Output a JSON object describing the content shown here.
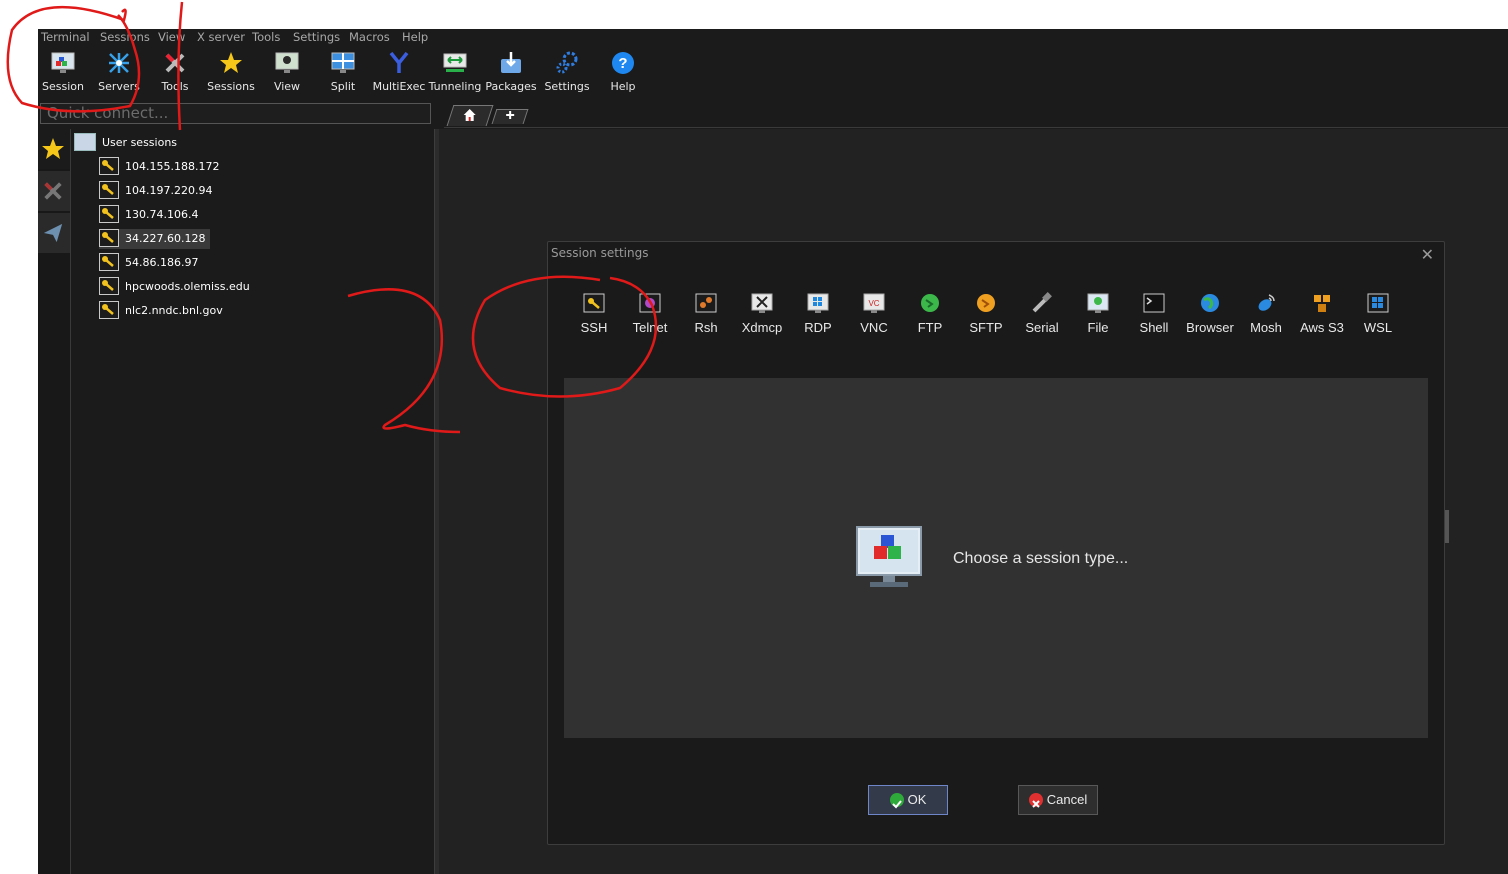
{
  "menu": [
    "Terminal",
    "Sessions",
    "View",
    "X server",
    "Tools",
    "Settings",
    "Macros",
    "Help"
  ],
  "toolbar": [
    {
      "label": "Session",
      "icon": "session-monitor-icon"
    },
    {
      "label": "Servers",
      "icon": "servers-icon"
    },
    {
      "label": "Tools",
      "icon": "tools-icon"
    },
    {
      "label": "Sessions",
      "icon": "star-icon"
    },
    {
      "label": "View",
      "icon": "view-icon"
    },
    {
      "label": "Split",
      "icon": "split-icon"
    },
    {
      "label": "MultiExec",
      "icon": "multiexec-icon"
    },
    {
      "label": "Tunneling",
      "icon": "tunneling-icon"
    },
    {
      "label": "Packages",
      "icon": "packages-icon"
    },
    {
      "label": "Settings",
      "icon": "gear-icon"
    },
    {
      "label": "Help",
      "icon": "help-icon"
    }
  ],
  "quick_connect": {
    "placeholder": "Quick connect..."
  },
  "tabs": {
    "home_icon": "home-icon",
    "add_icon": "plus-icon"
  },
  "sidebar": {
    "root_label": "User sessions",
    "sessions": [
      "104.155.188.172",
      "104.197.220.94",
      "130.74.106.4",
      "34.227.60.128",
      "54.86.186.97",
      "hpcwoods.olemiss.edu",
      "nlc2.nndc.bnl.gov"
    ],
    "selected": "34.227.60.128"
  },
  "dialog": {
    "title": "Session settings",
    "close": "✕",
    "session_types": [
      "SSH",
      "Telnet",
      "Rsh",
      "Xdmcp",
      "RDP",
      "VNC",
      "FTP",
      "SFTP",
      "Serial",
      "File",
      "Shell",
      "Browser",
      "Mosh",
      "Aws S3",
      "WSL"
    ],
    "prompt": "Choose a session type...",
    "ok_label": "OK",
    "cancel_label": "Cancel"
  },
  "colors": {
    "accent_blue": "#6f86c8",
    "ok_green": "#2eaa3a",
    "cancel_red": "#e03030",
    "annotation_red": "#e01919"
  }
}
